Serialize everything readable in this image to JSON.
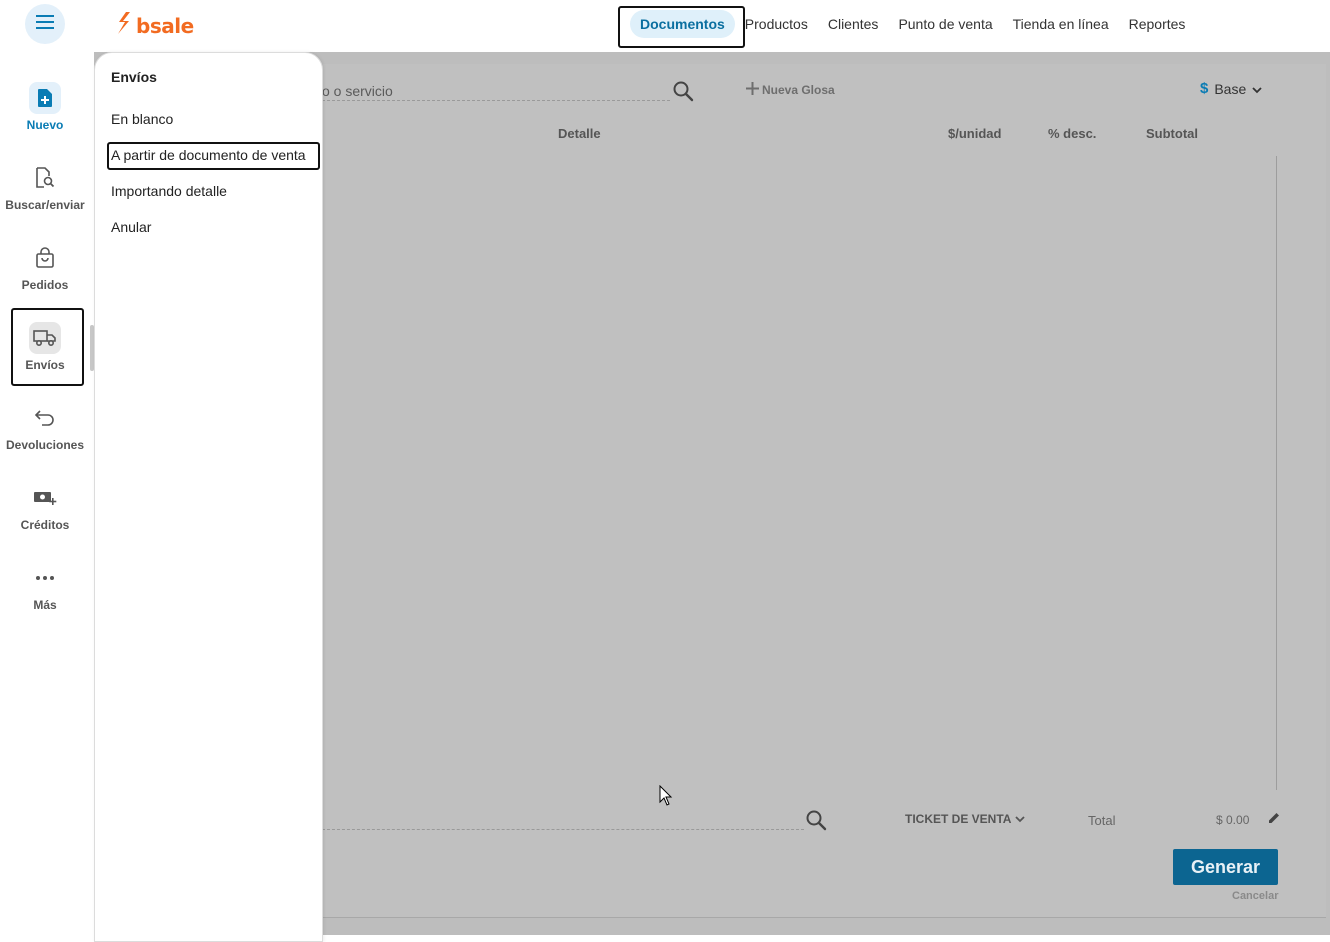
{
  "app": {
    "logo_text": "bsale",
    "brand_color": "#f26b21",
    "accent_color": "#0a7cb4"
  },
  "top_nav": {
    "items": [
      {
        "label": "Documentos",
        "active": true
      },
      {
        "label": "Productos"
      },
      {
        "label": "Clientes"
      },
      {
        "label": "Punto de venta"
      },
      {
        "label": "Tienda en línea"
      },
      {
        "label": "Reportes"
      }
    ]
  },
  "sidebar": {
    "items": [
      {
        "label": "Nuevo",
        "icon": "new-document-icon"
      },
      {
        "label": "Buscar/enviar",
        "icon": "search-document-icon"
      },
      {
        "label": "Pedidos",
        "icon": "shopping-bag-icon"
      },
      {
        "label": "Envíos",
        "icon": "truck-icon",
        "active": true
      },
      {
        "label": "Devoluciones",
        "icon": "return-arrow-icon"
      },
      {
        "label": "Créditos",
        "icon": "money-plus-icon"
      },
      {
        "label": "Más",
        "icon": "more-dots-icon"
      }
    ]
  },
  "flyout": {
    "title": "Envíos",
    "items": [
      {
        "label": "En blanco"
      },
      {
        "label": "A partir de documento de venta"
      },
      {
        "label": "Importando detalle"
      },
      {
        "label": "Anular"
      }
    ]
  },
  "document": {
    "search_placeholder": "o o servicio",
    "nueva_glosa_label": "Nueva Glosa",
    "currency_symbol": "$",
    "price_list": "Base",
    "columns": {
      "detalle": "Detalle",
      "unit_price": "$/unidad",
      "discount": "% desc.",
      "subtotal": "Subtotal"
    },
    "document_type": "TICKET DE VENTA",
    "total_label": "Total",
    "total_value": "$ 0.00",
    "generate_label": "Generar",
    "cancel_label": "Cancelar"
  }
}
